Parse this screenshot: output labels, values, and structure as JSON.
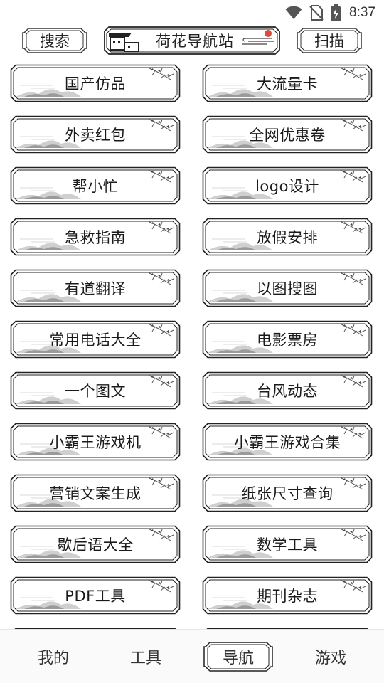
{
  "status_bar": {
    "time": "8:37",
    "icons": [
      "wifi-icon",
      "no-sim-icon",
      "battery-charging-icon"
    ]
  },
  "header": {
    "search_label": "搜索",
    "title": "荷花导航站",
    "scan_label": "扫描"
  },
  "grid": {
    "items": [
      {
        "label": "国产仿品"
      },
      {
        "label": "大流量卡"
      },
      {
        "label": "外卖红包"
      },
      {
        "label": "全网优惠卷"
      },
      {
        "label": "帮小忙"
      },
      {
        "label": "logo设计"
      },
      {
        "label": "急救指南"
      },
      {
        "label": "放假安排"
      },
      {
        "label": "有道翻译"
      },
      {
        "label": "以图搜图"
      },
      {
        "label": "常用电话大全"
      },
      {
        "label": "电影票房"
      },
      {
        "label": "一个图文"
      },
      {
        "label": "台风动态"
      },
      {
        "label": "小霸王游戏机"
      },
      {
        "label": "小霸王游戏合集"
      },
      {
        "label": "营销文案生成"
      },
      {
        "label": "纸张尺寸查询"
      },
      {
        "label": "歇后语大全"
      },
      {
        "label": "数学工具"
      },
      {
        "label": "PDF工具"
      },
      {
        "label": "期刊杂志"
      },
      {
        "label": ""
      },
      {
        "label": ""
      }
    ]
  },
  "bottom_nav": {
    "items": [
      {
        "label": "我的"
      },
      {
        "label": "工具"
      },
      {
        "label": "导航"
      },
      {
        "label": "游戏"
      }
    ],
    "active": "导航"
  },
  "colors": {
    "ink": "#222222",
    "accent": "#e04a3a",
    "background": "#ffffff"
  }
}
